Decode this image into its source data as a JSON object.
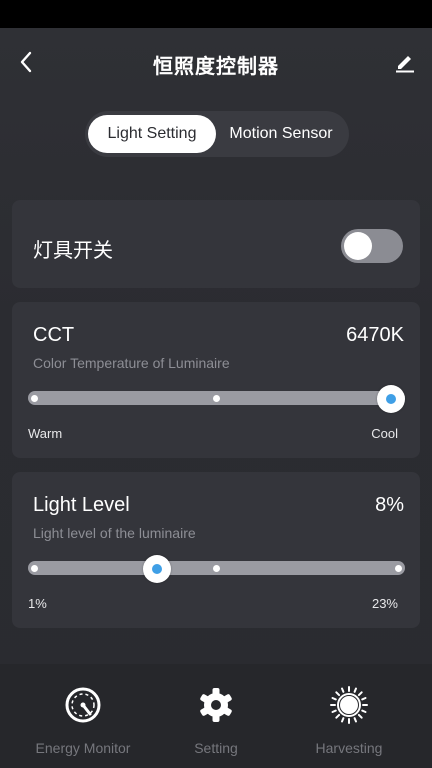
{
  "header": {
    "title": "恒照度控制器"
  },
  "tabs": [
    {
      "label": "Light Setting",
      "active": true
    },
    {
      "label": "Motion Sensor",
      "active": false
    }
  ],
  "switch_card": {
    "label": "灯具开关",
    "on": false
  },
  "cct_card": {
    "title": "CCT",
    "value": "6470K",
    "subtitle": "Color Temperature of Luminaire",
    "min_label": "Warm",
    "max_label": "Cool",
    "slider_fraction": 1.0
  },
  "level_card": {
    "title": "Light Level",
    "value": "8%",
    "subtitle": "Light level of the luminaire",
    "min_label": "1%",
    "max_label": "23%",
    "slider_fraction": 0.33
  },
  "nav": [
    {
      "label": "Energy Monitor",
      "icon": "gauge-icon"
    },
    {
      "label": "Setting",
      "icon": "gear-icon"
    },
    {
      "label": "Harvesting",
      "icon": "sun-icon"
    }
  ],
  "colors": {
    "accent": "#3f9fe6",
    "card": "#34353b",
    "background": "#2b2c31"
  }
}
